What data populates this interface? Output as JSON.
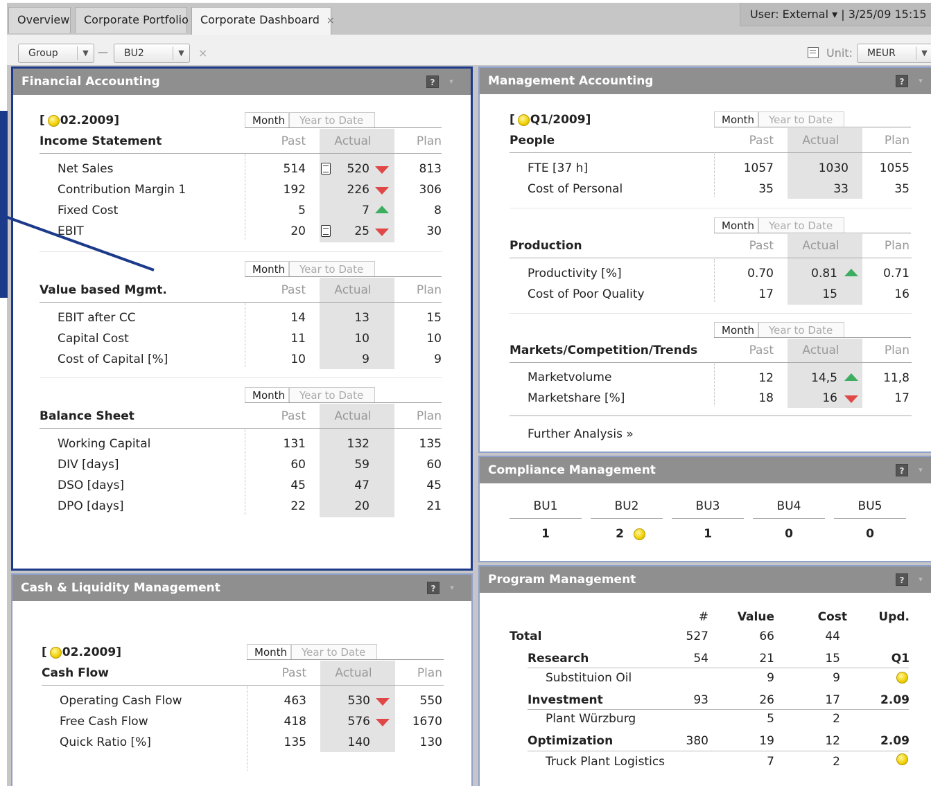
{
  "tabs": [
    {
      "label": "Overview"
    },
    {
      "label": "Corporate Portfolio"
    },
    {
      "label": "Corporate Dashboard",
      "close": "×"
    }
  ],
  "user_info": "User: External  ▾  |  3/25/09  15:15",
  "toolbar": {
    "group_label": "Group",
    "bu_label": "BU2",
    "dash": "—",
    "clear": "×",
    "unit_label": "Unit:",
    "unit_value": "MEUR"
  },
  "common": {
    "month": "Month",
    "ytd": "Year to Date",
    "past": "Past",
    "actual": "Actual",
    "plan": "Plan",
    "help": "?",
    "menu": "▾"
  },
  "fa": {
    "title": "Financial Accounting",
    "period": "02.2009",
    "income": {
      "title": "Income Statement",
      "rows": [
        {
          "label": "Net Sales",
          "past": "514",
          "actual": "520",
          "plan": "813"
        },
        {
          "label": "Contribution Margin 1",
          "past": "192",
          "actual": "226",
          "plan": "306"
        },
        {
          "label": "Fixed Cost",
          "past": "5",
          "actual": "7",
          "plan": "8"
        },
        {
          "label": "EBIT",
          "past": "20",
          "actual": "25",
          "plan": "30"
        }
      ]
    },
    "vbm": {
      "title": "Value based Mgmt.",
      "rows": [
        {
          "label": "EBIT after CC",
          "past": "14",
          "actual": "13",
          "plan": "15"
        },
        {
          "label": "Capital Cost",
          "past": "11",
          "actual": "10",
          "plan": "10"
        },
        {
          "label": "Cost of Capital [%]",
          "past": "10",
          "actual": "9",
          "plan": "9"
        }
      ]
    },
    "bs": {
      "title": "Balance Sheet",
      "rows": [
        {
          "label": "Working Capital",
          "past": "131",
          "actual": "132",
          "plan": "135"
        },
        {
          "label": "DIV [days]",
          "past": "60",
          "actual": "59",
          "plan": "60"
        },
        {
          "label": "DSO [days]",
          "past": "45",
          "actual": "47",
          "plan": "45"
        },
        {
          "label": "DPO [days]",
          "past": "22",
          "actual": "20",
          "plan": "21"
        }
      ]
    }
  },
  "cash": {
    "title": "Cash & Liquidity Management",
    "period": "02.2009",
    "section": "Cash Flow",
    "rows": [
      {
        "label": "Operating Cash Flow",
        "past": "463",
        "actual": "530",
        "plan": "550"
      },
      {
        "label": "Free Cash Flow",
        "past": "418",
        "actual": "576",
        "plan": "1670"
      },
      {
        "label": "Quick Ratio [%]",
        "past": "135",
        "actual": "140",
        "plan": "130"
      }
    ]
  },
  "ma": {
    "title": "Management Accounting",
    "period": "Q1/2009",
    "people": {
      "title": "People",
      "rows": [
        {
          "label": "FTE [37 h]",
          "past": "1057",
          "actual": "1030",
          "plan": "1055"
        },
        {
          "label": "Cost of Personal",
          "past": "35",
          "actual": "33",
          "plan": "35"
        }
      ]
    },
    "production": {
      "title": "Production",
      "rows": [
        {
          "label": "Productivity [%]",
          "past": "0.70",
          "actual": "0.81",
          "plan": "0.71"
        },
        {
          "label": "Cost of Poor Quality",
          "past": "17",
          "actual": "15",
          "plan": "16"
        }
      ]
    },
    "markets": {
      "title": "Markets/Competition/Trends",
      "rows": [
        {
          "label": "Marketvolume",
          "past": "12",
          "actual": "14,5",
          "plan": "11,8"
        },
        {
          "label": "Marketshare [%]",
          "past": "18",
          "actual": "16",
          "plan": "17"
        }
      ]
    },
    "further": "Further Analysis »"
  },
  "compliance": {
    "title": "Compliance Management",
    "units": [
      {
        "label": "BU1",
        "value": "1"
      },
      {
        "label": "BU2",
        "value": "2"
      },
      {
        "label": "BU3",
        "value": "1"
      },
      {
        "label": "BU4",
        "value": "0"
      },
      {
        "label": "BU5",
        "value": "0"
      }
    ]
  },
  "program": {
    "title": "Program Management",
    "headers": {
      "num": "#",
      "value": "Value",
      "cost": "Cost",
      "upd": "Upd."
    },
    "total": {
      "label": "Total",
      "num": "527",
      "value": "66",
      "cost": "44"
    },
    "groups": [
      {
        "label": "Research",
        "num": "54",
        "value": "21",
        "cost": "15",
        "upd": "Q1",
        "sub": {
          "label": "Substituion Oil",
          "value": "9",
          "cost": "9"
        }
      },
      {
        "label": "Investment",
        "num": "93",
        "value": "26",
        "cost": "17",
        "upd": "2.09",
        "sub": {
          "label": "Plant Würzburg",
          "value": "5",
          "cost": "2"
        }
      },
      {
        "label": "Optimization",
        "num": "380",
        "value": "19",
        "cost": "12",
        "upd": "2.09",
        "sub": {
          "label": "Truck Plant Logistics",
          "value": "7",
          "cost": "2"
        }
      }
    ]
  }
}
